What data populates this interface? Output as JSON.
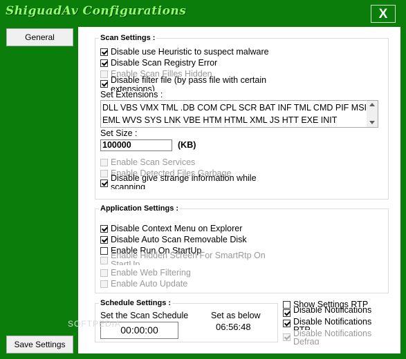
{
  "window": {
    "title": "ShiguadAv Configurations",
    "close_label": "X"
  },
  "sidebar": {
    "general_label": "General",
    "save_label": "Save Settings"
  },
  "scan": {
    "title": "Scan Settings :",
    "heuristic": "Disable use Heuristic to suspect malware",
    "registry": "Disable Scan Registry Error",
    "hidden": "Enable Scan Filles Hidden",
    "filter": "Disable filter file (by pass file with certain extensions)",
    "ext_label": "Set Extensions :",
    "extensions": "DLL VBS VMX TML .DB COM CPL SCR BAT INF TML CMD PIF MSI EML WVS SYS LNK VBE HTM HTML XML JS HTT EXE INIT",
    "size_label": "Set Size :",
    "size_value": "100000",
    "size_unit": "(KB)",
    "services": "Enable Scan Services",
    "garbage": "Enable Detected Files Garbage",
    "strange": "Disable give strange  information while scanning"
  },
  "app": {
    "title": "Application Settings :",
    "context": "Disable Context Menu on Explorer",
    "removable": "Disable Auto Scan Removable Disk",
    "startup": "Enable Run On StartUp",
    "hidden_screen": "Enable Hidden Screen For SmartRtp On StartUp",
    "web": "Enable Web Filtering",
    "update": "Enable Auto Update"
  },
  "schedule": {
    "title": "Schedule Settings :",
    "set_label": "Set the Scan Schedule",
    "time_value": "00:00:00",
    "below_label": "Set as below",
    "below_value": "06:56:48"
  },
  "extra": {
    "show_rtp": "Show Settings RTP",
    "notif1": "Disable Notifications",
    "notif2": "Disable Notifications RTP",
    "notif3": "Disable Notifications Defrag"
  },
  "watermark": "SOFTPEDIA"
}
